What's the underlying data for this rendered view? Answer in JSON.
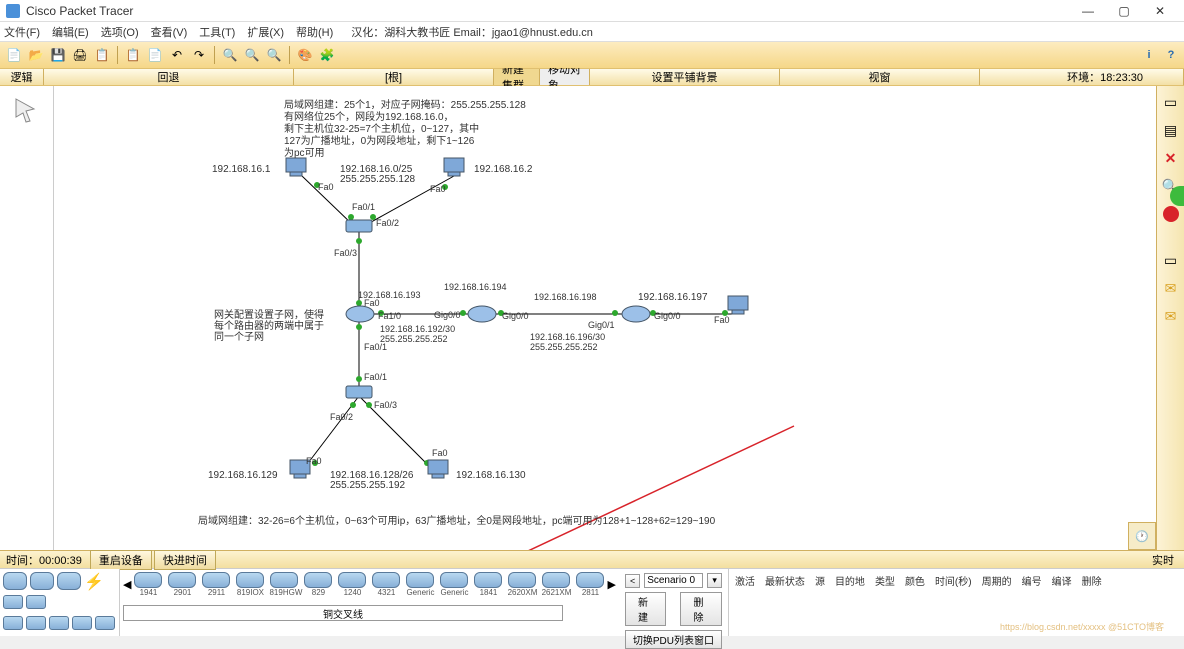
{
  "title": "Cisco Packet Tracer",
  "menus": {
    "file": "文件(F)",
    "edit": "编辑(E)",
    "options": "选项(O)",
    "view": "查看(V)",
    "tools": "工具(T)",
    "ext": "扩展(X)",
    "help": "帮助(H)"
  },
  "menu_info": "汉化：湖科大教书匠  Email：jgao1@hnust.edu.cn",
  "secondbar": {
    "logic": "逻辑",
    "back": "回退",
    "root": "[根]",
    "new_cluster": "新建集群",
    "move_obj": "移动对象",
    "tile_bg": "设置平铺背景",
    "viewport": "视窗",
    "env_time": "环境：18:23:30"
  },
  "canvas": {
    "note_a_l1": "局域网组建：25个1，对应子网掩码：255.255.255.128",
    "note_a_l2": "有网络位25个，网段为192.168.16.0，",
    "note_a_l3": "剩下主机位32-25=7个主机位，0~127，其中",
    "note_a_l4": "127为广播地址，0为网段地址，剩下1~126",
    "note_a_l5": "为pc可用",
    "ip_pc0": "192.168.16.1",
    "net_top": "192.168.16.0/25",
    "mask_top": "255.255.255.128",
    "ip_pc1": "192.168.16.2",
    "fa0": "Fa0",
    "fa01": "Fa0/1",
    "fa02": "Fa0/2",
    "fa03": "Fa0/3",
    "fa10": "Fa1/0",
    "gig00": "Gig0/0",
    "gig01": "Gig0/1",
    "note_gw_l1": "网关配置设置子网，使得",
    "note_gw_l2": "每个路由器的两端中属于",
    "note_gw_l3": "同一个子网",
    "ip_r_left": "192.168.16.193",
    "ip_r_right": "192.168.16.194",
    "net_mid": "192.168.16.192/30",
    "mask_mid": "255.255.255.252",
    "ip_r_far": "192.168.16.198",
    "net_far": "192.168.16.196/30",
    "mask_far": "255.255.255.252",
    "ip_pc_far": "192.168.16.197",
    "ip_pc2": "192.168.16.129",
    "net_bot": "192.168.16.128/26",
    "mask_bot": "255.255.255.192",
    "ip_pc3": "192.168.16.130",
    "note_b": "局域网组建：32-26=6个主机位，0~63个可用ip，63广播地址，全0是网段地址，pc端可用为128+1~128+62=129~190"
  },
  "bottom": {
    "time": "时间：00:00:39",
    "reset": "重启设备",
    "fast": "快进时间",
    "realtime": "实时"
  },
  "device_models": [
    "1941",
    "2901",
    "2911",
    "819IOX",
    "819HGW",
    "829",
    "1240",
    "4321",
    "Generic",
    "Generic",
    "1841",
    "2620XM",
    "2621XM",
    "2811"
  ],
  "device_hint": "铜交叉线",
  "scenario": {
    "sel": "Scenario 0",
    "new": "新建",
    "del": "删除",
    "toggle": "切换PDU列表窗口"
  },
  "pdu_cols": {
    "c1": "激活",
    "c2": "最新状态",
    "c3": "源",
    "c4": "目的地",
    "c5": "类型",
    "c6": "颜色",
    "c7": "时间(秒)",
    "c8": "周期的",
    "c9": "编号",
    "c10": "编译",
    "c11": "删除"
  },
  "watermark": "https://blog.csdn.net/xxxxx @51CTO博客"
}
